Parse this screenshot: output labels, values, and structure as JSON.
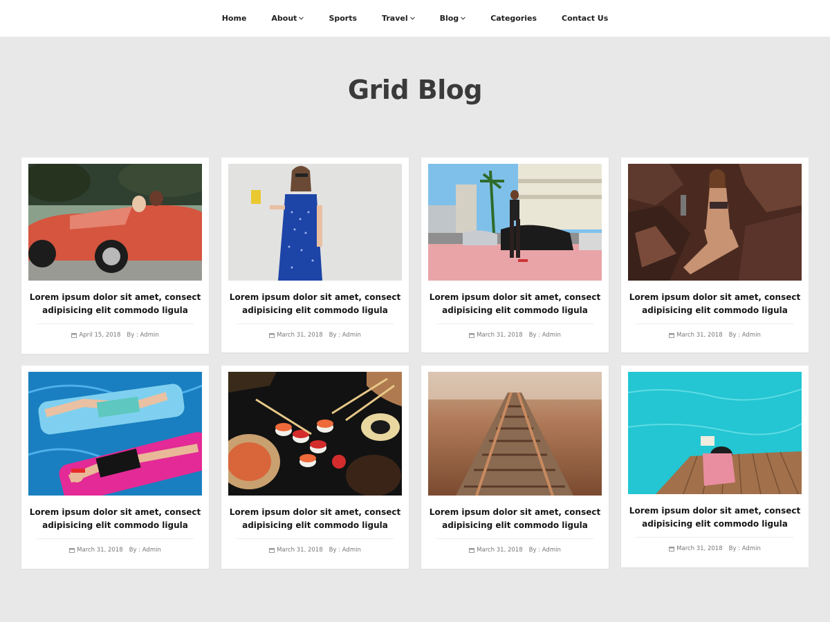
{
  "nav": {
    "items": [
      {
        "label": "Home",
        "dropdown": false
      },
      {
        "label": "About",
        "dropdown": true
      },
      {
        "label": "Sports",
        "dropdown": false
      },
      {
        "label": "Travel",
        "dropdown": true
      },
      {
        "label": "Blog",
        "dropdown": true
      },
      {
        "label": "Categories",
        "dropdown": false
      },
      {
        "label": "Contact Us",
        "dropdown": false
      }
    ]
  },
  "page": {
    "title": "Grid Blog",
    "background_color": "#e8e8e8"
  },
  "posts": [
    {
      "image": "red vintage convertible car with women",
      "title": "Lorem ipsum dolor sit amet, consect adipisicing elit commodo ligula",
      "date": "April 15, 2018",
      "author": "By : Admin"
    },
    {
      "image": "woman in blue polka dot dress holding cup",
      "title": "Lorem ipsum dolor sit amet, consect adipisicing elit commodo ligula",
      "date": "March 31, 2018",
      "author": "By : Admin"
    },
    {
      "image": "man skateboarding on street with palm trees",
      "title": "Lorem ipsum dolor sit amet, consect adipisicing elit commodo ligula",
      "date": "March 31, 2018",
      "author": "By : Admin"
    },
    {
      "image": "woman sitting on dark rocks",
      "title": "Lorem ipsum dolor sit amet, consect adipisicing elit commodo ligula",
      "date": "March 31, 2018",
      "author": "By : Admin"
    },
    {
      "image": "women on pool floats",
      "title": "Lorem ipsum dolor sit amet, consect adipisicing elit commodo ligula",
      "date": "March 31, 2018",
      "author": "By : Admin"
    },
    {
      "image": "sushi with chopsticks",
      "title": "Lorem ipsum dolor sit amet, consect adipisicing elit commodo ligula",
      "date": "March 31, 2018",
      "author": "By : Admin"
    },
    {
      "image": "railway tracks",
      "title": "Lorem ipsum dolor sit amet, consect adipisicing elit commodo ligula",
      "date": "March 31, 2018",
      "author": "By : Admin"
    },
    {
      "image": "person reading on wooden dock by turquoise water",
      "title": "Lorem ipsum dolor sit amet, consect adipisicing elit commodo ligula",
      "date": "March 31, 2018",
      "author": "By : Admin"
    }
  ],
  "icons": {
    "calendar": "calendar-icon",
    "caret": "chevron-down-icon"
  }
}
